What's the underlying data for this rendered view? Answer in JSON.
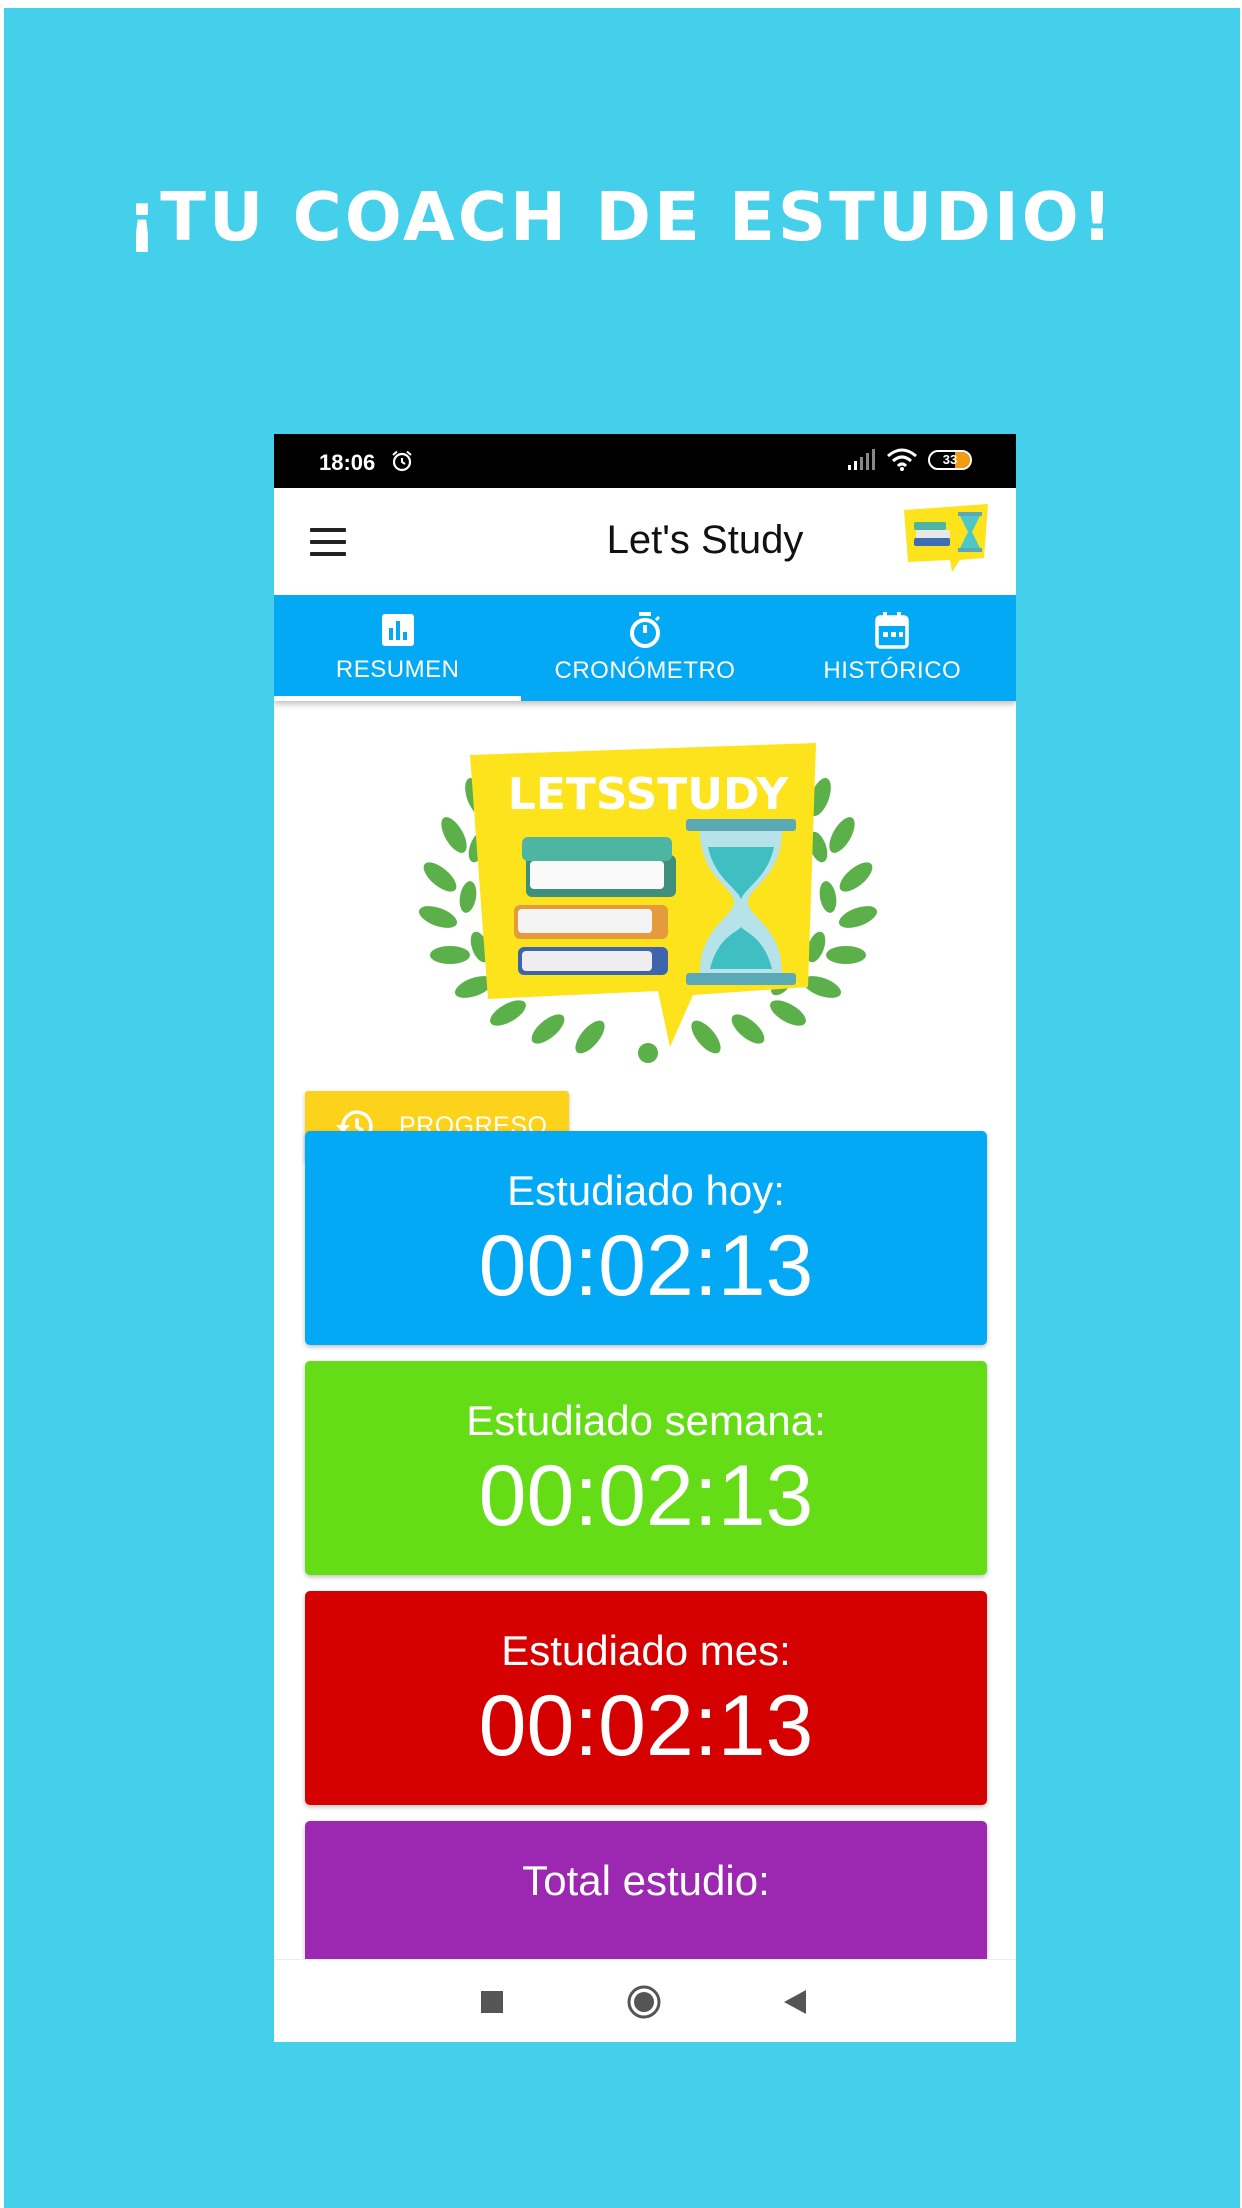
{
  "poster": {
    "headline": "¡TU COACH DE ESTUDIO!",
    "background_color": "#44cfeb"
  },
  "status_bar": {
    "time": "18:06",
    "battery": "33",
    "icons": [
      "alarm-icon",
      "signal-icon",
      "wifi-icon",
      "battery-icon"
    ]
  },
  "app_bar": {
    "title": "Let's Study",
    "menu_icon": "hamburger-menu-icon",
    "logo": "app-logo-books-hourglass"
  },
  "tabs": [
    {
      "label": "RESUMEN",
      "icon": "bar-chart-icon",
      "active": true
    },
    {
      "label": "CRONÓMETRO",
      "icon": "stopwatch-icon",
      "active": false
    },
    {
      "label": "HISTÓRICO",
      "icon": "calendar-icon",
      "active": false
    }
  ],
  "hero": {
    "logo_text": "LETSSTUDY"
  },
  "progress_button": {
    "label": "PROGRESO",
    "icon": "history-icon",
    "color": "#fdd21a"
  },
  "stats": [
    {
      "label": "Estudiado hoy:",
      "value": "00:02:13",
      "color": "#03a9f4"
    },
    {
      "label": "Estudiado semana:",
      "value": "00:02:13",
      "color": "#64dd17"
    },
    {
      "label": "Estudiado mes:",
      "value": "00:02:13",
      "color": "#d50000"
    },
    {
      "label": "Total estudio:",
      "value": "",
      "color": "#9c27b0"
    }
  ],
  "nav_bar": {
    "icons": [
      "recents-square-icon",
      "home-circle-icon",
      "back-triangle-icon"
    ]
  }
}
